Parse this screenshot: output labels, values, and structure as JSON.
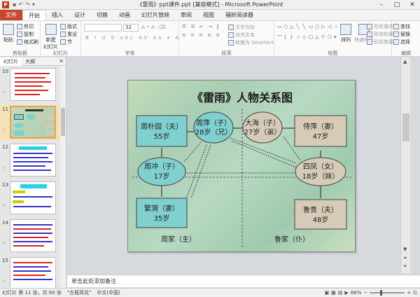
{
  "window": {
    "title": "《雷雨》ppt课件.ppt [兼容模式] - Microsoft PowerPoint",
    "app_icon": "P"
  },
  "tabs": [
    {
      "label": "文件"
    },
    {
      "label": "开始"
    },
    {
      "label": "插入"
    },
    {
      "label": "设计"
    },
    {
      "label": "切换"
    },
    {
      "label": "动画"
    },
    {
      "label": "幻灯片放映"
    },
    {
      "label": "审阅"
    },
    {
      "label": "视图"
    },
    {
      "label": "福昕阅读器"
    }
  ],
  "ribbon": {
    "clipboard": {
      "label": "剪贴板",
      "paste": "粘贴",
      "cut": "剪切",
      "copy": "复制",
      "format_painter": "格式刷"
    },
    "slides": {
      "label": "幻灯片",
      "new_slide": "新建\n幻灯片",
      "layout": "版式",
      "reset": "重设",
      "section": "节"
    },
    "font": {
      "label": "字体",
      "font_size": "32"
    },
    "paragraph": {
      "label": "段落",
      "text_direction": "文字方向",
      "align_text": "对齐文本",
      "smartart": "转换为 SmartArt"
    },
    "drawing": {
      "label": "绘图",
      "arrange": "排列",
      "quick_styles": "快速样式",
      "shape_fill": "形状填充",
      "shape_outline": "形状轮廓",
      "shape_effects": "形状效果"
    },
    "editing": {
      "label": "编辑",
      "find": "查找",
      "replace": "替换",
      "select": "选择"
    }
  },
  "left_pane": {
    "tabs": [
      "幻灯片",
      "大纲"
    ],
    "thumbnails": [
      {
        "num": "10"
      },
      {
        "num": "11",
        "selected": true
      },
      {
        "num": "12"
      },
      {
        "num": "13"
      },
      {
        "num": "14"
      },
      {
        "num": "15"
      }
    ]
  },
  "slide": {
    "title": "《雷雨》人物关系图",
    "nodes": [
      {
        "name": "周朴园（夫）",
        "age": "55岁"
      },
      {
        "name": "周萍（子）",
        "age": "28岁（兄）"
      },
      {
        "name": "大海（子）",
        "age": "27岁（弟）"
      },
      {
        "name": "侍萍（妻）",
        "age": "47岁"
      },
      {
        "name": "周冲（子）",
        "age": "17岁"
      },
      {
        "name": "四凤（女）",
        "age": "18岁（妹）"
      },
      {
        "name": "繁漪（妻）",
        "age": "35岁"
      },
      {
        "name": "鲁贵（夫）",
        "age": "48岁"
      }
    ],
    "zhou_family": "周家（主）",
    "lu_family": "鲁家（仆）"
  },
  "notes": {
    "placeholder": "单击此处添加备注"
  },
  "status": {
    "slide_info": "幻灯片 第 11 张，共 60 张",
    "theme": "\"古瓶荷花\"",
    "language": "中文(中国)",
    "zoom": "66%",
    "zoom_level": 0.66
  }
}
